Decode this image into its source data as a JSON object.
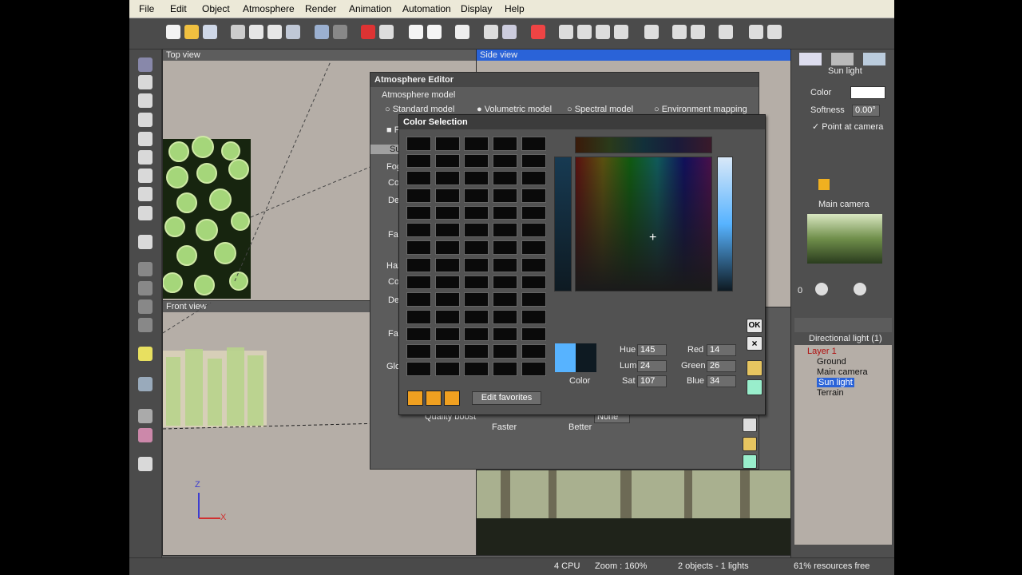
{
  "menu": [
    "File",
    "Edit",
    "Object",
    "Atmosphere",
    "Render",
    "Animation",
    "Automation",
    "Display",
    "Help"
  ],
  "views": {
    "top": "Top view",
    "side": "Side view",
    "front": "Front view"
  },
  "atmosphere_editor": {
    "title": "Atmosphere Editor",
    "model_label": "Atmosphere model",
    "models": [
      "Standard model",
      "Volumetric model",
      "Spectral model",
      "Environment mapping"
    ],
    "selected_model": "Volumetric model",
    "tab_fragment": "Su",
    "check_fragment": "F",
    "left_labels": [
      "Fog",
      "Col",
      "De",
      "Fal",
      "Haz",
      "Col",
      "De",
      "Fal",
      "Glo"
    ],
    "quality_boost": "Quality boost",
    "faster": "Faster",
    "better": "Better",
    "none_value": "None"
  },
  "color_selection": {
    "title": "Color Selection",
    "color_label": "Color",
    "hue_label": "Hue",
    "hue": "145",
    "lum_label": "Lum",
    "lum": "24",
    "sat_label": "Sat",
    "sat": "107",
    "red_label": "Red",
    "red": "14",
    "green_label": "Green",
    "green": "26",
    "blue_label": "Blue",
    "blue": "34",
    "edit_favorites": "Edit favorites",
    "ok": "OK",
    "close": "×",
    "swatch_rows": 14,
    "swatch_cols": 5,
    "new_color": "#57b3ff",
    "old_color": "#0e1a22"
  },
  "right_panel": {
    "sun_title": "Sun light",
    "color_label": "Color",
    "softness_label": "Softness",
    "softness_value": "0.00°",
    "point_at_camera": "Point at camera",
    "camera_title": "Main camera",
    "zero": "0",
    "tree_title": "Directional light (1)",
    "tree": [
      "Layer 1",
      "Ground",
      "Main camera",
      "Sun light",
      "Terrain"
    ]
  },
  "status": {
    "cpu": "4 CPU",
    "zoom": "Zoom : 160%",
    "objects": "2 objects - 1 lights",
    "resources": "61% resources free"
  }
}
